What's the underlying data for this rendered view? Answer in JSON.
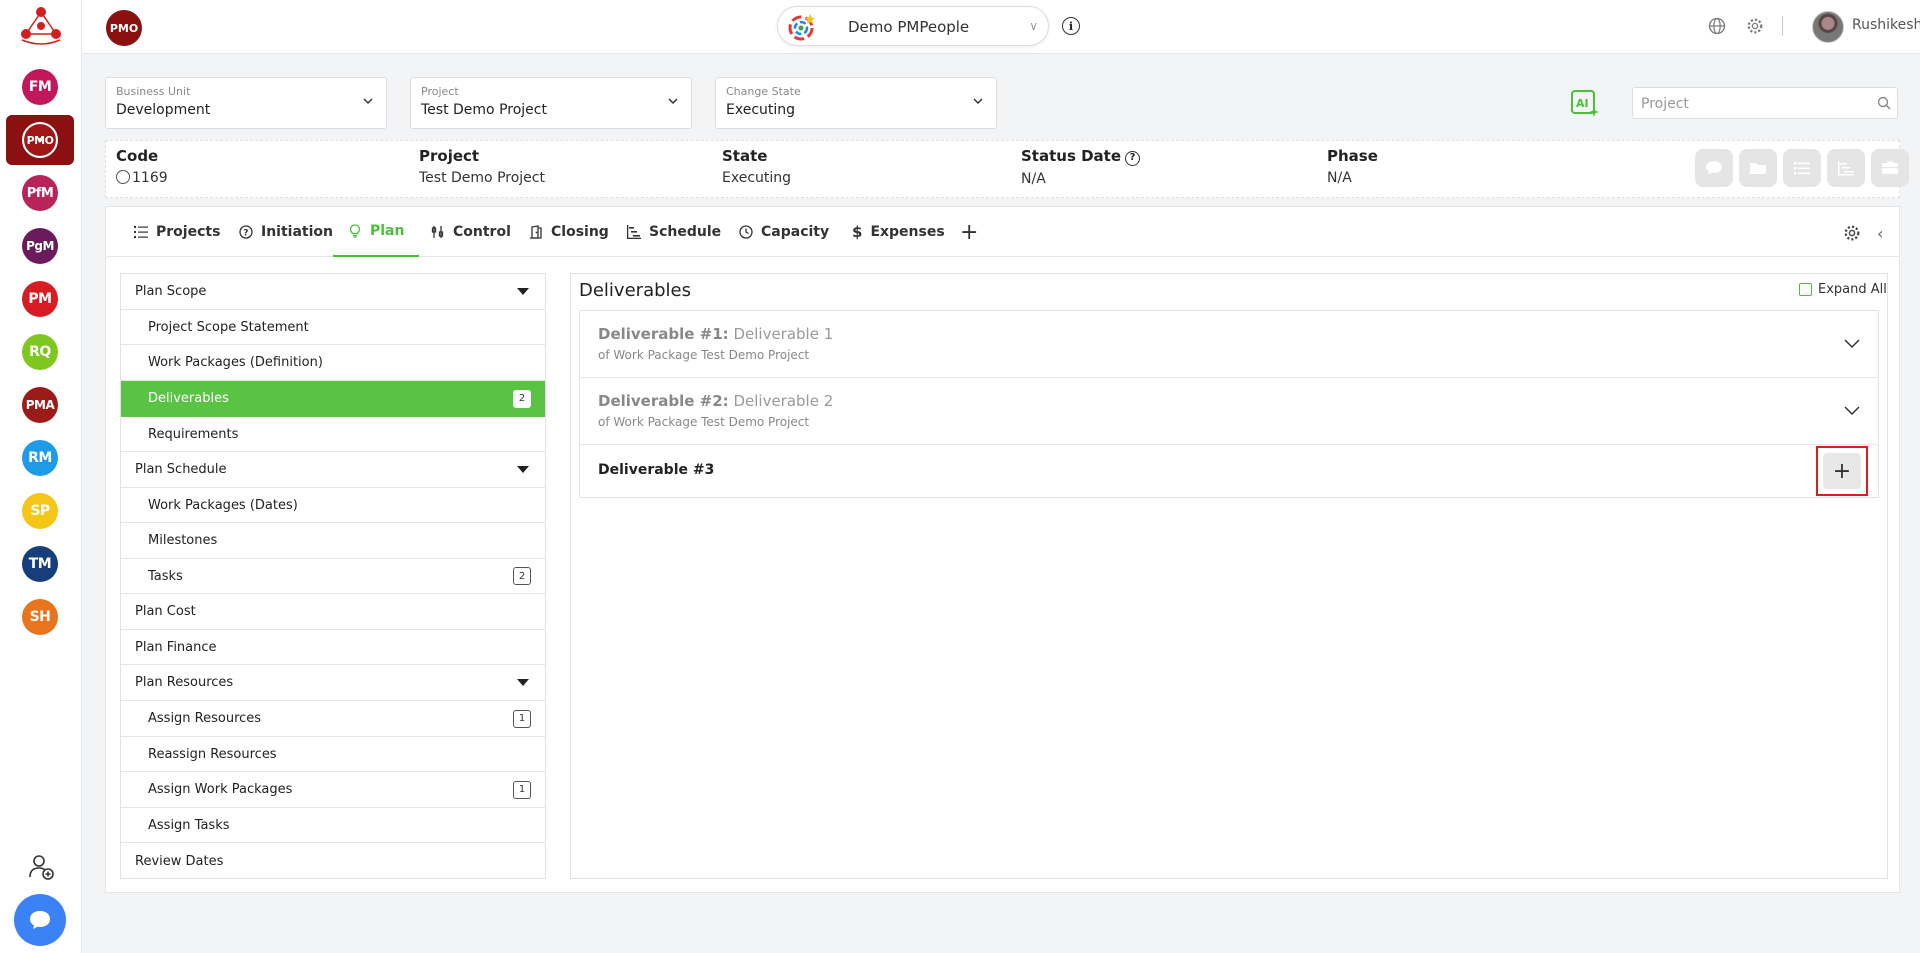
{
  "rail": {
    "items": [
      {
        "label": "FM",
        "color": "#c2185b"
      },
      {
        "label": "PMO",
        "color": "#8b1111"
      },
      {
        "label": "PfM",
        "color": "#b8235a"
      },
      {
        "label": "PgM",
        "color": "#6a1b5c"
      },
      {
        "label": "PM",
        "color": "#d81b22"
      },
      {
        "label": "RQ",
        "color": "#7fc71f"
      },
      {
        "label": "PMA",
        "color": "#9b1a1a"
      },
      {
        "label": "RM",
        "color": "#1e9be6"
      },
      {
        "label": "SP",
        "color": "#f5c518"
      },
      {
        "label": "TM",
        "color": "#153e7a"
      },
      {
        "label": "SH",
        "color": "#e8751e"
      }
    ],
    "accent": "#8b1111"
  },
  "topbar": {
    "pmo_badge": "PMO",
    "workspace": "Demo PMPeople",
    "user_name": "Rushikesh"
  },
  "selectors": [
    {
      "label": "Business Unit",
      "value": "Development"
    },
    {
      "label": "Project",
      "value": "Test Demo Project"
    },
    {
      "label": "Change State",
      "value": "Executing"
    }
  ],
  "search": {
    "placeholder": "Project"
  },
  "info": {
    "code_label": "Code",
    "code_value": "1169",
    "project_label": "Project",
    "project_value": "Test Demo Project",
    "state_label": "State",
    "state_value": "Executing",
    "status_date_label": "Status Date",
    "status_date_value": "N/A",
    "phase_label": "Phase",
    "phase_value": "N/A"
  },
  "tabs": [
    {
      "label": "Projects",
      "icon": "list-icon"
    },
    {
      "label": "Initiation",
      "icon": "question-circle-icon"
    },
    {
      "label": "Plan",
      "icon": "bulb-icon",
      "active": true
    },
    {
      "label": "Control",
      "icon": "sliders-icon"
    },
    {
      "label": "Closing",
      "icon": "door-icon"
    },
    {
      "label": "Schedule",
      "icon": "gantt-icon"
    },
    {
      "label": "Capacity",
      "icon": "clock-icon"
    },
    {
      "label": "Expenses",
      "icon": "dollar-icon"
    }
  ],
  "nav": {
    "plan_scope": "Plan Scope",
    "project_scope_statement": "Project Scope Statement",
    "work_packages_definition": "Work Packages (Definition)",
    "deliverables": "Deliverables",
    "deliverables_count": "2",
    "requirements": "Requirements",
    "plan_schedule": "Plan Schedule",
    "work_packages_dates": "Work Packages (Dates)",
    "milestones": "Milestones",
    "tasks": "Tasks",
    "tasks_count": "2",
    "plan_cost": "Plan Cost",
    "plan_finance": "Plan Finance",
    "plan_resources": "Plan Resources",
    "assign_resources": "Assign Resources",
    "assign_resources_count": "1",
    "reassign_resources": "Reassign Resources",
    "assign_work_packages": "Assign Work Packages",
    "assign_work_packages_count": "1",
    "assign_tasks": "Assign Tasks",
    "review_dates": "Review Dates"
  },
  "panel": {
    "title": "Deliverables",
    "expand_all": "Expand All",
    "deliverables": [
      {
        "prefix": "Deliverable #1:",
        "name": "Deliverable 1",
        "sub": "of Work Package Test Demo Project"
      },
      {
        "prefix": "Deliverable #2:",
        "name": "Deliverable 2",
        "sub": "of Work Package Test Demo Project"
      }
    ],
    "new_deliverable": "Deliverable #3",
    "add_symbol": "+"
  },
  "colors": {
    "accent_green": "#4bbf3a",
    "active_row": "#5ac343",
    "highlight_red": "#e01b1b"
  }
}
